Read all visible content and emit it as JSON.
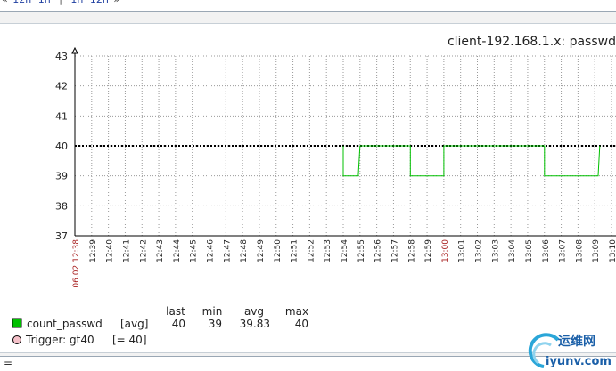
{
  "nav": {
    "left_arrow": "«",
    "links_left": [
      "12h",
      "1h"
    ],
    "separator": "|",
    "links_right": [
      "1h",
      "12h"
    ],
    "right_arrow": "»"
  },
  "graph_title": "client-192.168.1.x: passwd",
  "chart_data": {
    "type": "line",
    "title": "client-192.168.1.x: passwd",
    "ylim": [
      37,
      43
    ],
    "y_ticks": [
      37,
      38,
      39,
      40,
      41,
      42,
      43
    ],
    "grid": true,
    "x_tick_labels": [
      "06.02 12:38",
      "12:39",
      "12:40",
      "12:41",
      "12:42",
      "12:43",
      "12:44",
      "12:45",
      "12:46",
      "12:47",
      "12:48",
      "12:49",
      "12:50",
      "12:51",
      "12:52",
      "12:53",
      "12:54",
      "12:55",
      "12:56",
      "12:57",
      "12:58",
      "12:59",
      "13:00",
      "13:01",
      "13:02",
      "13:03",
      "13:04",
      "13:05",
      "13:06",
      "13:07",
      "13:08",
      "13:09",
      "13:10"
    ],
    "x_tick_highlight": [
      "06.02 12:38",
      "13:00"
    ],
    "series": [
      {
        "name": "count_passwd",
        "color": "#00c000",
        "points": [
          [
            "12:54.0",
            40
          ],
          [
            "12:54.0",
            39
          ],
          [
            "12:54.9",
            39
          ],
          [
            "12:55.0",
            40
          ],
          [
            "12:58.0",
            40
          ],
          [
            "12:58.0",
            39
          ],
          [
            "13:00.0",
            39
          ],
          [
            "13:00.0",
            40
          ],
          [
            "13:06.0",
            40
          ],
          [
            "13:06.0",
            39
          ],
          [
            "13:09.2",
            39
          ],
          [
            "13:09.3",
            40
          ]
        ]
      }
    ],
    "trigger": {
      "name": "Trigger: gt40",
      "value": 40,
      "color": "#000000"
    }
  },
  "legend": {
    "headers": [
      "last",
      "min",
      "avg",
      "max"
    ],
    "series_name": "count_passwd",
    "series_func": "[avg]",
    "series_values": [
      "40",
      "39",
      "39.83",
      "40"
    ],
    "series_color": "#00c000",
    "trigger_label": "Trigger: gt40",
    "trigger_value": "[= 40]",
    "trigger_color": "#f4c0c8"
  },
  "bottom_bar": {
    "text": "="
  },
  "watermark": {
    "cn_text": "运维网",
    "url_text": "iyunv.com"
  }
}
